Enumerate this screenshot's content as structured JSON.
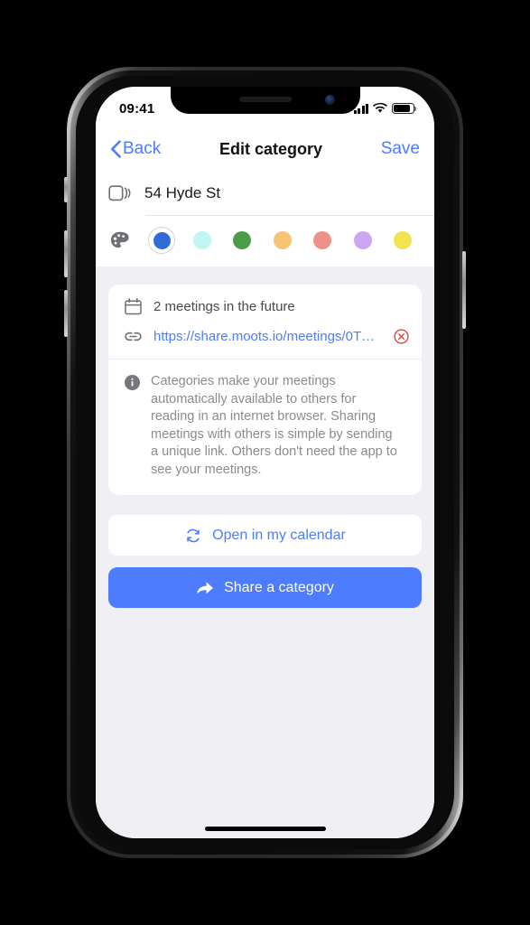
{
  "device": {
    "frame": "iphone-x",
    "screen_bg": "#EFEFF4",
    "accent": "#4D7CFE"
  },
  "status_bar": {
    "time": "09:41",
    "signal_icon": "cellular-bars-icon",
    "wifi_icon": "wifi-icon",
    "battery_icon": "battery-icon"
  },
  "nav_bar": {
    "back_label": "Back",
    "back_icon": "chevron-left-icon",
    "title": "Edit category",
    "save_label": "Save"
  },
  "name_field": {
    "icon": "layers-stack-icon",
    "value": "54 Hyde St",
    "placeholder": "Category name"
  },
  "color_picker": {
    "icon": "palette-icon",
    "selected_index": 0,
    "swatches": [
      {
        "name": "blue",
        "hex": "#2F6BD8"
      },
      {
        "name": "cyan",
        "hex": "#BFF5F2"
      },
      {
        "name": "green",
        "hex": "#4A9C4A"
      },
      {
        "name": "orange",
        "hex": "#F7C473"
      },
      {
        "name": "salmon",
        "hex": "#EE9287"
      },
      {
        "name": "purple",
        "hex": "#CDA6F2"
      },
      {
        "name": "yellow",
        "hex": "#F2E44E"
      }
    ]
  },
  "info_card": {
    "meetings": {
      "icon": "calendar-icon",
      "text": "2 meetings in the future"
    },
    "link": {
      "icon": "link-icon",
      "url": "https://share.moots.io/meetings/0T…",
      "delete_icon": "delete-circle-icon",
      "delete_color": "#E8412E"
    },
    "note": {
      "icon": "info-icon",
      "text": "Categories make your meetings automatically available to others for reading in an internet browser. Sharing meetings with others is simple by sending a unique link. Others don't need the app to see your meetings."
    }
  },
  "actions": {
    "open_calendar": {
      "icon": "sync-circle-icon",
      "label": "Open in my calendar"
    },
    "share_category": {
      "icon": "share-arrow-icon",
      "label": "Share a category"
    }
  },
  "home_indicator": "home-indicator"
}
